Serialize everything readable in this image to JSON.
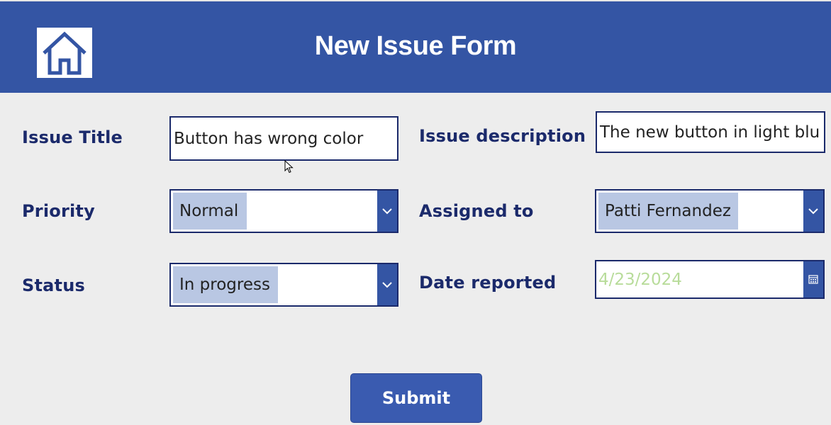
{
  "header": {
    "title": "New Issue Form",
    "home_icon": "home-icon",
    "background_color": "#3455a4"
  },
  "form": {
    "issue_title": {
      "label": "Issue Title",
      "value": "Button has wrong color"
    },
    "issue_description": {
      "label": "Issue description",
      "value": "The new button in light blu"
    },
    "priority": {
      "label": "Priority",
      "selected": "Normal",
      "icon": "chevron-down-icon"
    },
    "assigned_to": {
      "label": "Assigned to",
      "selected": "Patti Fernandez",
      "icon": "chevron-down-icon"
    },
    "status": {
      "label": "Status",
      "selected": "In progress",
      "icon": "chevron-down-icon"
    },
    "date_reported": {
      "label": "Date reported",
      "value": "4/23/2024",
      "icon": "calendar-icon"
    }
  },
  "actions": {
    "submit_label": "Submit"
  },
  "colors": {
    "label": "#1b2a6b",
    "selection_highlight": "#b9c7e3",
    "date_text": "#b8dc9a",
    "accent": "#3455a4"
  }
}
